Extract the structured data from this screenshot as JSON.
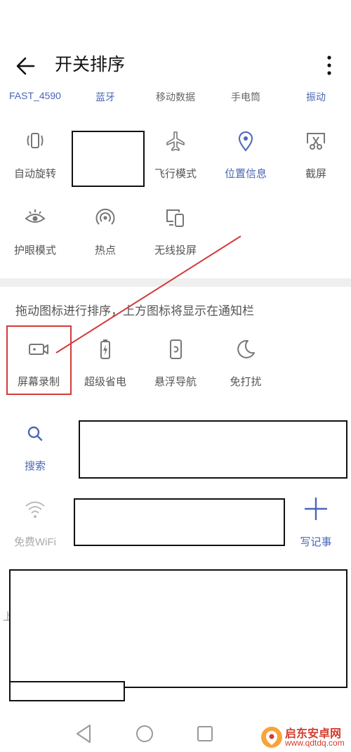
{
  "header": {
    "title": "开关排序"
  },
  "top_row": [
    "FAST_4590",
    "蓝牙",
    "移动数据",
    "手电筒",
    "振动"
  ],
  "active_tiles": [
    {
      "label": "自动旋转",
      "icon": "rotate-icon"
    },
    {
      "label": "飞行模式",
      "icon": "airplane-icon"
    },
    {
      "label": "位置信息",
      "icon": "location-pin-icon"
    },
    {
      "label": "截屏",
      "icon": "screenshot-scissors-icon"
    },
    {
      "label": "护眼模式",
      "icon": "eye-icon"
    },
    {
      "label": "热点",
      "icon": "hotspot-icon"
    },
    {
      "label": "无线投屏",
      "icon": "cast-screen-icon"
    }
  ],
  "instruction": "拖动图标进行排序，上方图标将显示在通知栏",
  "inactive_tiles": [
    {
      "label": "屏幕录制",
      "icon": "video-camera-icon"
    },
    {
      "label": "超级省电",
      "icon": "battery-bolt-icon"
    },
    {
      "label": "悬浮导航",
      "icon": "floating-nav-icon"
    },
    {
      "label": "免打扰",
      "icon": "moon-icon"
    },
    {
      "label": "搜索",
      "icon": "search-icon"
    },
    {
      "label": "免费WiFi",
      "icon": "wifi-icon"
    },
    {
      "label": "写记事",
      "icon": "plus-icon"
    }
  ],
  "partial_text": "上",
  "watermark": {
    "name": "启东安卓网",
    "url": "www.qdtdq.com"
  },
  "colors": {
    "accent": "#4a67b7",
    "highlight": "#d23b3b",
    "watermark": "#d43b2e"
  }
}
